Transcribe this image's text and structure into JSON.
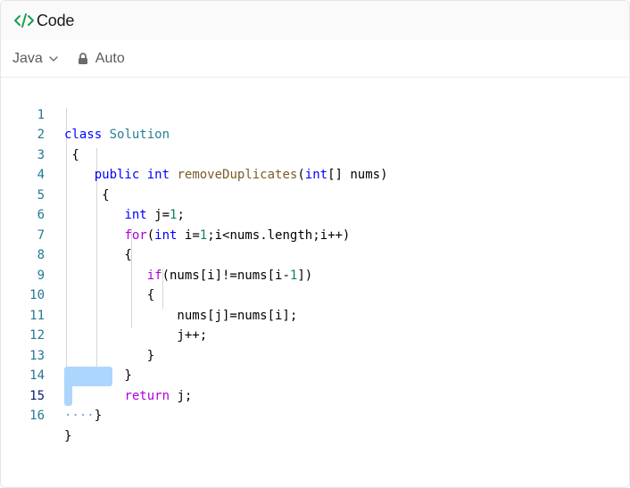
{
  "header": {
    "title": "Code",
    "icon": "code-icon",
    "accent_color": "#1a9e4f"
  },
  "toolbar": {
    "language": "Java",
    "language_icon": "chevron-down-icon",
    "mode": "Auto",
    "mode_icon": "lock-icon"
  },
  "editor": {
    "active_line": 15,
    "lines": [
      {
        "num": "1",
        "code": "class Solution"
      },
      {
        "num": "2",
        "code": " {"
      },
      {
        "num": "3",
        "code": "    public int removeDuplicates(int[] nums)"
      },
      {
        "num": "4",
        "code": "     {"
      },
      {
        "num": "5",
        "code": "        int j=1;"
      },
      {
        "num": "6",
        "code": "        for(int i=1;i<nums.length;i++)"
      },
      {
        "num": "7",
        "code": "        {"
      },
      {
        "num": "8",
        "code": "           if(nums[i]!=nums[i-1])"
      },
      {
        "num": "9",
        "code": "           {"
      },
      {
        "num": "10",
        "code": "               nums[j]=nums[i];"
      },
      {
        "num": "11",
        "code": "               j++;"
      },
      {
        "num": "12",
        "code": "           }"
      },
      {
        "num": "13",
        "code": "        }"
      },
      {
        "num": "14",
        "code": "        return j;"
      },
      {
        "num": "15",
        "code": "    }"
      },
      {
        "num": "16",
        "code": "}"
      }
    ]
  }
}
